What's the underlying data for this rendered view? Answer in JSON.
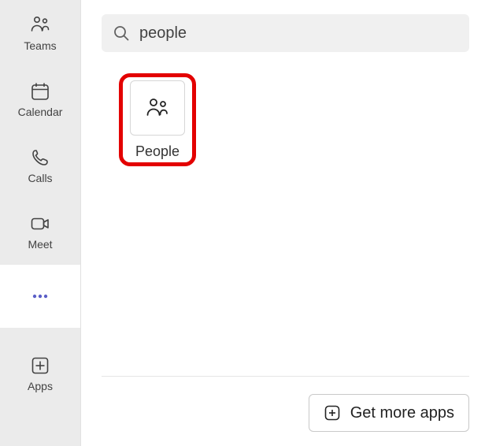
{
  "sidebar": {
    "items": [
      {
        "label": "Teams",
        "name": "nav-teams",
        "icon": "teams-icon"
      },
      {
        "label": "Calendar",
        "name": "nav-calendar",
        "icon": "calendar-icon"
      },
      {
        "label": "Calls",
        "name": "nav-calls",
        "icon": "calls-icon"
      },
      {
        "label": "Meet",
        "name": "nav-meet",
        "icon": "meet-icon"
      }
    ],
    "more_label": "",
    "apps_label": "Apps"
  },
  "search": {
    "value": "people"
  },
  "result": {
    "label": "People"
  },
  "footer": {
    "get_more_label": "Get more apps"
  }
}
